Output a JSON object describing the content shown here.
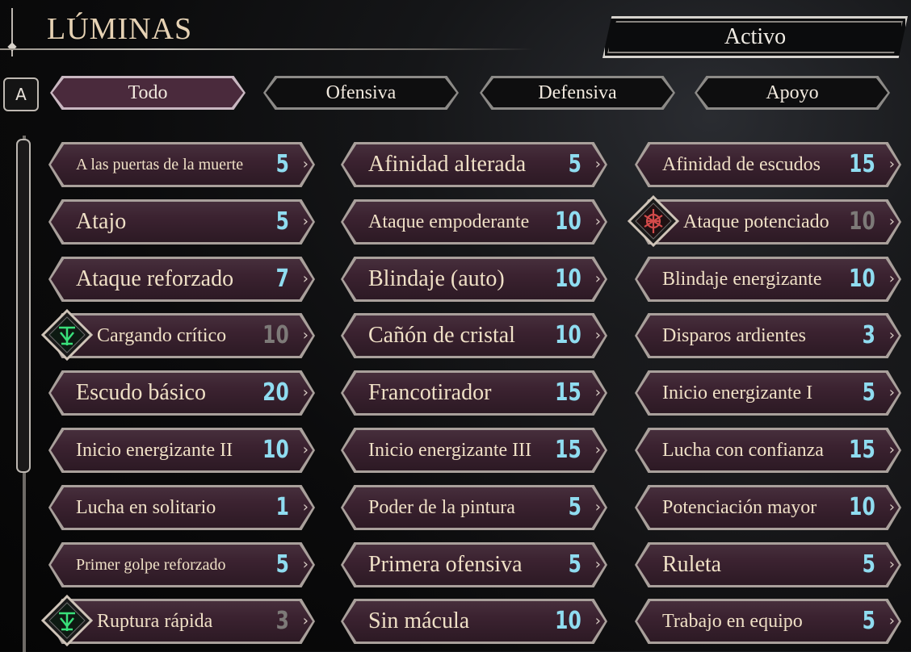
{
  "header": {
    "title": "LÚMINAS",
    "status": "Activo",
    "key_hint": "A"
  },
  "tabs": [
    {
      "label": "Todo",
      "active": true
    },
    {
      "label": "Ofensiva",
      "active": false
    },
    {
      "label": "Defensiva",
      "active": false
    },
    {
      "label": "Apoyo",
      "active": false
    }
  ],
  "colors": {
    "card_fill": "#3b2230",
    "cost_text": "#8fdcf0",
    "cost_dim": "#7d7a78",
    "name_text": "#efe0c6"
  },
  "luminas": [
    {
      "name": "A las puertas de la muerte",
      "cost": "5",
      "size": "s",
      "equipped": false
    },
    {
      "name": "Afinidad alterada",
      "cost": "5",
      "size": "l",
      "equipped": false
    },
    {
      "name": "Afinidad de escudos",
      "cost": "15",
      "size": "m",
      "equipped": false
    },
    {
      "name": "Atajo",
      "cost": "5",
      "size": "l",
      "equipped": false
    },
    {
      "name": "Ataque empoderante",
      "cost": "10",
      "size": "m",
      "equipped": false
    },
    {
      "name": "Ataque potenciado",
      "cost": "10",
      "size": "m",
      "equipped": true,
      "icon": "red-rune-icon"
    },
    {
      "name": "Ataque reforzado",
      "cost": "7",
      "size": "l",
      "equipped": false
    },
    {
      "name": "Blindaje (auto)",
      "cost": "10",
      "size": "l",
      "equipped": false
    },
    {
      "name": "Blindaje energizante",
      "cost": "10",
      "size": "m",
      "equipped": false
    },
    {
      "name": "Cargando crítico",
      "cost": "10",
      "size": "m",
      "equipped": true,
      "icon": "green-rune-icon"
    },
    {
      "name": "Cañón de cristal",
      "cost": "10",
      "size": "l",
      "equipped": false
    },
    {
      "name": "Disparos ardientes",
      "cost": "3",
      "size": "m",
      "equipped": false
    },
    {
      "name": "Escudo básico",
      "cost": "20",
      "size": "l",
      "equipped": false
    },
    {
      "name": "Francotirador",
      "cost": "15",
      "size": "l",
      "equipped": false
    },
    {
      "name": "Inicio energizante I",
      "cost": "5",
      "size": "m",
      "equipped": false
    },
    {
      "name": "Inicio energizante II",
      "cost": "10",
      "size": "m",
      "equipped": false
    },
    {
      "name": "Inicio energizante III",
      "cost": "15",
      "size": "m",
      "equipped": false
    },
    {
      "name": "Lucha con confianza",
      "cost": "15",
      "size": "m",
      "equipped": false
    },
    {
      "name": "Lucha en solitario",
      "cost": "1",
      "size": "m",
      "equipped": false
    },
    {
      "name": "Poder de la pintura",
      "cost": "5",
      "size": "m",
      "equipped": false
    },
    {
      "name": "Potenciación mayor",
      "cost": "10",
      "size": "m",
      "equipped": false
    },
    {
      "name": "Primer golpe reforzado",
      "cost": "5",
      "size": "s",
      "equipped": false
    },
    {
      "name": "Primera ofensiva",
      "cost": "5",
      "size": "l",
      "equipped": false
    },
    {
      "name": "Ruleta",
      "cost": "5",
      "size": "l",
      "equipped": false
    },
    {
      "name": "Ruptura rápida",
      "cost": "3",
      "size": "m",
      "equipped": true,
      "icon": "green-rune-icon"
    },
    {
      "name": "Sin mácula",
      "cost": "10",
      "size": "l",
      "equipped": false
    },
    {
      "name": "Trabajo en equipo",
      "cost": "5",
      "size": "m",
      "equipped": false
    }
  ]
}
